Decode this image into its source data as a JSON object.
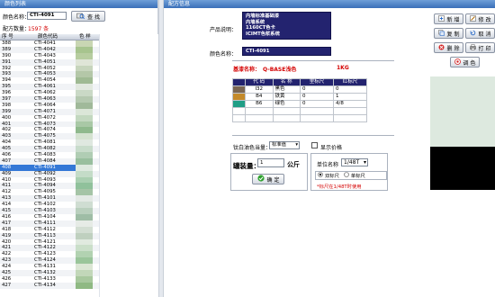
{
  "left_panel": {
    "title": "颜色列表",
    "color_name_label": "颜色名称：",
    "color_name_value": "CTI-4091",
    "search_button": "查 找",
    "color_count_label": "配方数量：",
    "color_count_value": "1597 条",
    "columns": [
      "序 号",
      "颜色代码",
      "色 样"
    ],
    "rows": [
      {
        "no": "388",
        "code": "CTI-4041",
        "swatch": "#c9d6b3"
      },
      {
        "no": "389",
        "code": "CTI-4042",
        "swatch": "#a7c48e"
      },
      {
        "no": "390",
        "code": "CTI-4043",
        "swatch": "#b7cda0"
      },
      {
        "no": "391",
        "code": "CTI-4051",
        "swatch": "#dfe5d7"
      },
      {
        "no": "392",
        "code": "CTI-4052",
        "swatch": "#c7d5bd"
      },
      {
        "no": "393",
        "code": "CTI-4053",
        "swatch": "#b4c7a8"
      },
      {
        "no": "394",
        "code": "CTI-4054",
        "swatch": "#9fba93"
      },
      {
        "no": "395",
        "code": "CTI-4061",
        "swatch": "#e1e8de"
      },
      {
        "no": "396",
        "code": "CTI-4062",
        "swatch": "#cad9c6"
      },
      {
        "no": "397",
        "code": "CTI-4063",
        "swatch": "#b5c9b0"
      },
      {
        "no": "398",
        "code": "CTI-4064",
        "swatch": "#a0b99a"
      },
      {
        "no": "399",
        "code": "CTI-4071",
        "swatch": "#dbe6d8"
      },
      {
        "no": "400",
        "code": "CTI-4072",
        "swatch": "#c3d8c0"
      },
      {
        "no": "401",
        "code": "CTI-4073",
        "swatch": "#a9c8a6"
      },
      {
        "no": "402",
        "code": "CTI-4074",
        "swatch": "#8fb98d"
      },
      {
        "no": "403",
        "code": "CTI-4075",
        "swatch": "#d4e2d0"
      },
      {
        "no": "404",
        "code": "CTI-4081",
        "swatch": "#dfe8e0"
      },
      {
        "no": "405",
        "code": "CTI-4082",
        "swatch": "#c8dccb"
      },
      {
        "no": "406",
        "code": "CTI-4083",
        "swatch": "#b0cdb4"
      },
      {
        "no": "407",
        "code": "CTI-4084",
        "swatch": "#98bf9e"
      },
      {
        "no": "408",
        "code": "CTI-4091",
        "swatch": "#dde9df",
        "selected": true
      },
      {
        "no": "409",
        "code": "CTI-4092",
        "swatch": "#c4dcc8"
      },
      {
        "no": "410",
        "code": "CTI-4093",
        "swatch": "#aacfb1"
      },
      {
        "no": "411",
        "code": "CTI-4094",
        "swatch": "#90c19b"
      },
      {
        "no": "412",
        "code": "CTI-4095",
        "swatch": "#a5c4a6"
      },
      {
        "no": "413",
        "code": "CTI-4101",
        "swatch": "#e3e9e4"
      },
      {
        "no": "414",
        "code": "CTI-4102",
        "swatch": "#cfddd2"
      },
      {
        "no": "415",
        "code": "CTI-4103",
        "swatch": "#b9cfbd"
      },
      {
        "no": "416",
        "code": "CTI-4104",
        "swatch": "#9fbda6"
      },
      {
        "no": "417",
        "code": "CTI-4111",
        "swatch": "#e6ebe6"
      },
      {
        "no": "418",
        "code": "CTI-4112",
        "swatch": "#d3ded3"
      },
      {
        "no": "419",
        "code": "CTI-4113",
        "swatch": "#bfd0bf"
      },
      {
        "no": "420",
        "code": "CTI-4121",
        "swatch": "#e0eadf"
      },
      {
        "no": "421",
        "code": "CTI-4122",
        "swatch": "#cadfc9"
      },
      {
        "no": "422",
        "code": "CTI-4123",
        "swatch": "#b2d2b1"
      },
      {
        "no": "423",
        "code": "CTI-4124",
        "swatch": "#9ac59a"
      },
      {
        "no": "424",
        "code": "CTI-4131",
        "swatch": "#dbe6d4"
      },
      {
        "no": "425",
        "code": "CTI-4132",
        "swatch": "#c2d7b9"
      },
      {
        "no": "426",
        "code": "CTI-4133",
        "swatch": "#a8c89e"
      },
      {
        "no": "427",
        "code": "CTI-4134",
        "swatch": "#8fb983"
      }
    ]
  },
  "main_panel": {
    "title": "配方信息",
    "product_label": "产品说明：",
    "product_lines": [
      "内墙标准基础漆",
      "内墙系统",
      "1160CT色卡",
      "ICIMT色浆系统"
    ],
    "color_name_label": "颜色名称：",
    "color_name_value": "CTI-4091",
    "base_label": "基漆名称：",
    "base_value": "Q-BASE浅色",
    "base_qty": "1KG",
    "table_headers": [
      "代 码",
      "名 称",
      "里标尺",
      "红标尺"
    ],
    "table_rows": [
      {
        "code": "I32",
        "name": "黑色",
        "a": "0",
        "b": "0",
        "swatch": "#7a6652"
      },
      {
        "code": "B4",
        "name": "铁黄",
        "a": "0",
        "b": "1",
        "swatch": "#c48a2a"
      },
      {
        "code": "B6",
        "name": "绿色",
        "a": "0",
        "b": "4/8",
        "swatch": "#1f9e86"
      }
    ],
    "unit_select_label": "钛白油色当量：",
    "unit_select_value": "标准值",
    "show_price_label": "显示价格",
    "fill_label": "罐装量：",
    "fill_value": "1",
    "fill_unit": "公斤",
    "unit_label": "单位名称",
    "unit_value": "1/48T",
    "confirm_button": "确 定",
    "radio_1": "双标尺",
    "radio_2": "单标尺",
    "note": "*标尺在1/48T时使用"
  },
  "right_buttons": {
    "new": "新 增",
    "modify": "修 改",
    "copy": "复 制",
    "cancel": "取 消",
    "delete": "删 除",
    "print": "打 印",
    "mix": "调 色"
  },
  "preview": {
    "upper_color": "#dde9df",
    "lower_color": "#000000"
  },
  "colors": {
    "accent": "#3478d6",
    "navy": "#23236f",
    "red": "#d40000"
  }
}
